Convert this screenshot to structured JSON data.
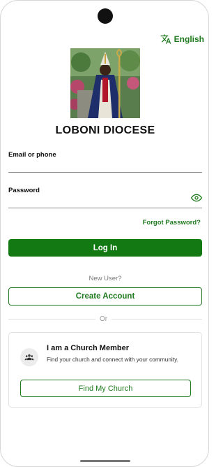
{
  "language": {
    "label": "English",
    "icon": "translate-icon"
  },
  "organization": {
    "name": "LOBONI DIOCESE"
  },
  "login_form": {
    "email_label": "Email or phone",
    "email_value": "",
    "password_label": "Password",
    "password_value": "",
    "show_password_icon": "eye-icon",
    "forgot_password_label": "Forgot Password?",
    "login_button_label": "Log In"
  },
  "signup": {
    "new_user_text": "New User?",
    "create_account_label": "Create Account"
  },
  "divider_text": "Or",
  "member_card": {
    "icon": "people-icon",
    "title": "I am a Church Member",
    "description": "Find your church and connect with your community.",
    "button_label": "Find My Church"
  },
  "colors": {
    "primary_green": "#137a13",
    "text_green": "#1f7a1f",
    "muted_text": "#777777"
  }
}
